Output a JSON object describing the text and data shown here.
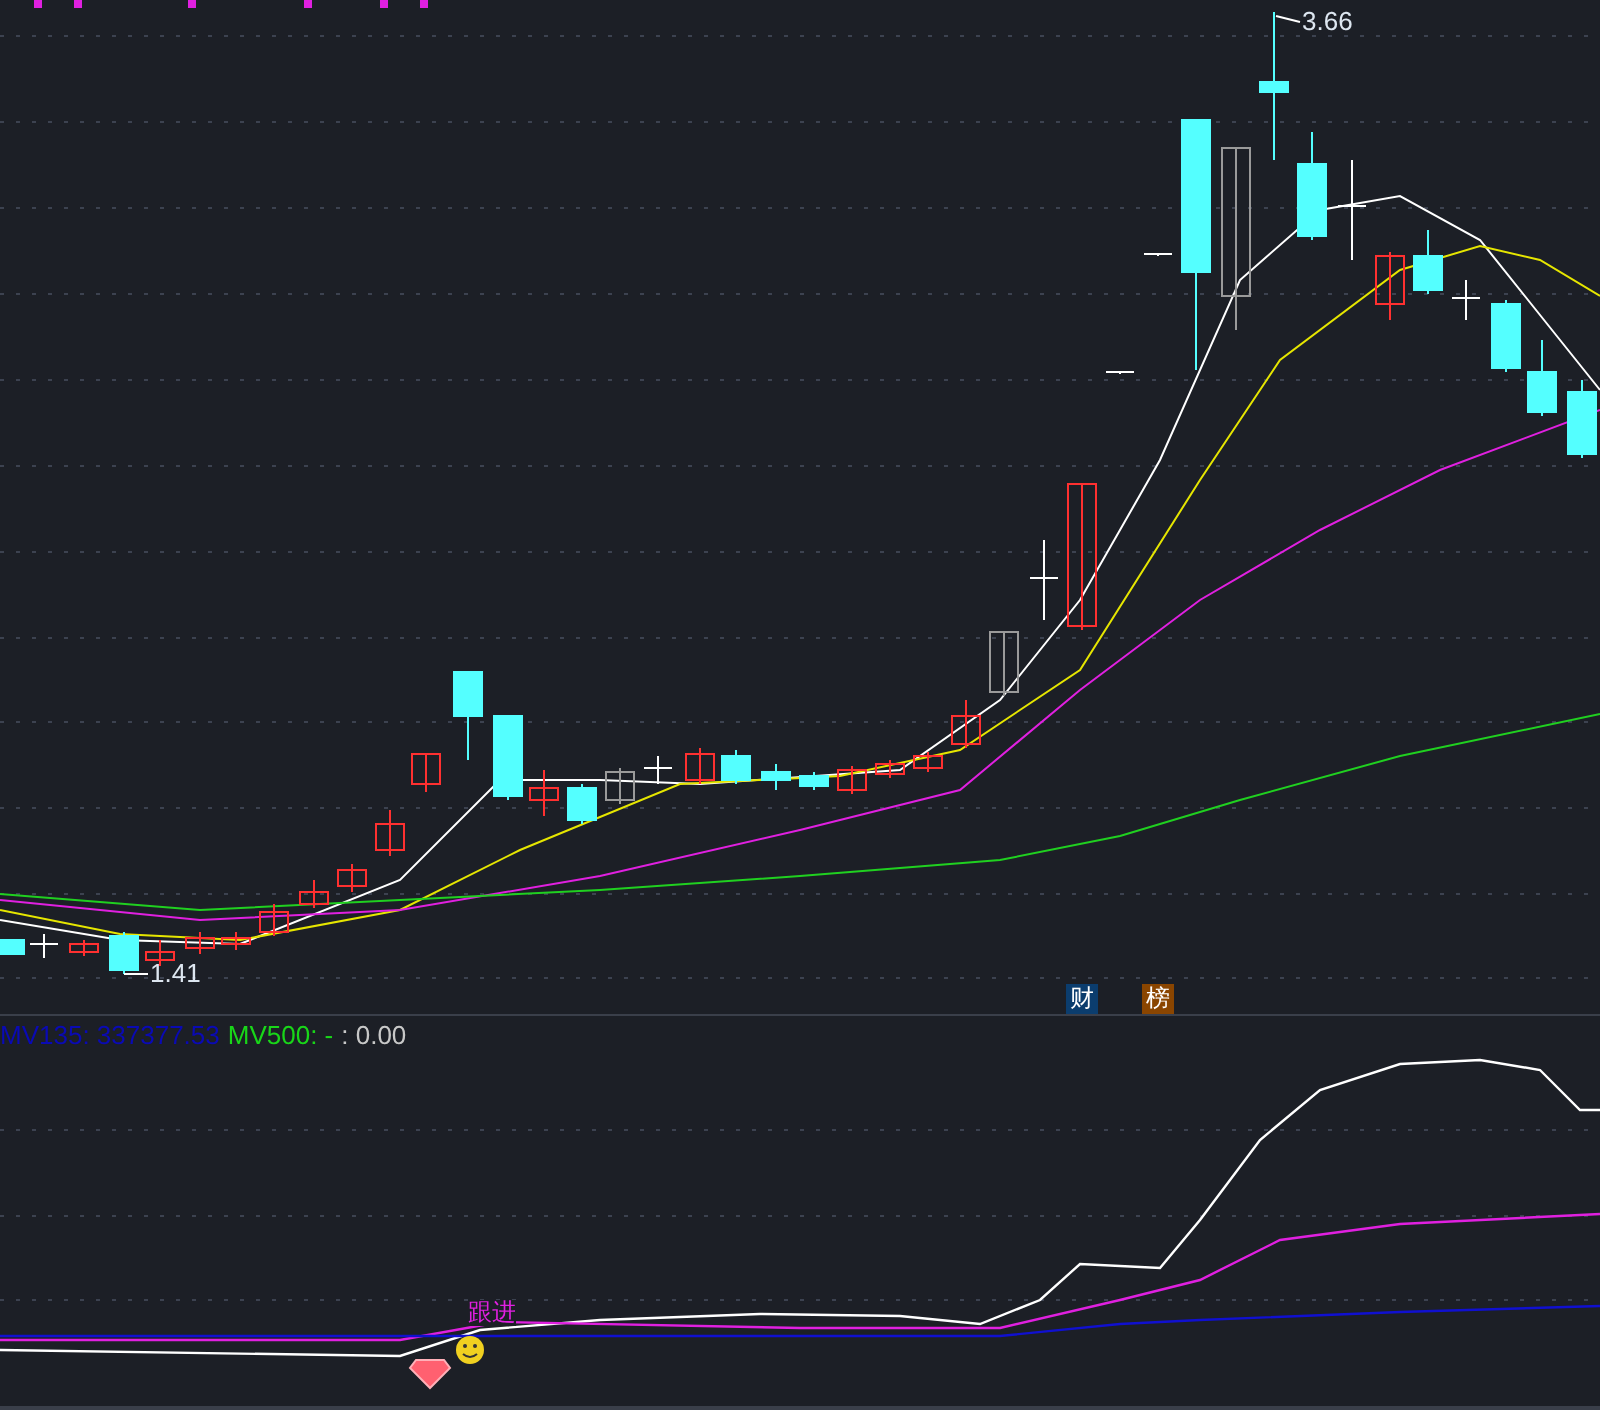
{
  "price_panel": {
    "high_label": "3.66",
    "low_label": "1.41",
    "badges": [
      {
        "text": "财",
        "color": "#0b3d6e"
      },
      {
        "text": "榜",
        "color": "#8a4500"
      }
    ]
  },
  "indicator_panel": {
    "legend": [
      {
        "text": "MV135: 337377.53",
        "color": "#0a0ab4"
      },
      {
        "text": "MV500: -",
        "color": "#19d619"
      },
      {
        "text": ": 0.00",
        "color": "#c8c8c8"
      }
    ],
    "signal_label": "跟进"
  }
}
